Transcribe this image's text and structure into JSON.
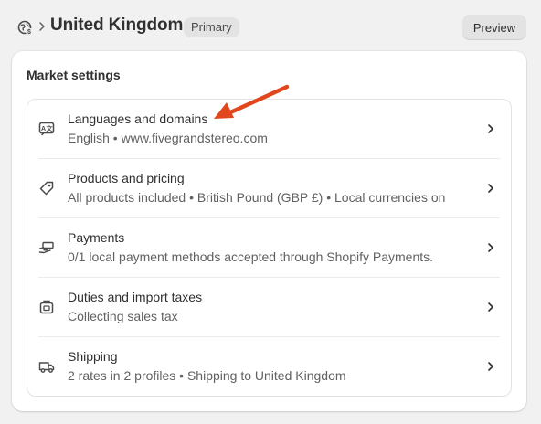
{
  "header": {
    "title": "United Kingdom",
    "badge": "Primary",
    "preview_label": "Preview"
  },
  "card": {
    "title": "Market settings"
  },
  "settings": [
    {
      "title": "Languages and domains",
      "description": "English • www.fivegrandstereo.com",
      "icon": "translate-icon"
    },
    {
      "title": "Products and pricing",
      "description": "All products included • British Pound (GBP £) • Local currencies on",
      "icon": "price-tag-icon"
    },
    {
      "title": "Payments",
      "description": "0/1 local payment methods accepted through Shopify Payments.",
      "icon": "hand-cash-icon"
    },
    {
      "title": "Duties and import taxes",
      "description": "Collecting sales tax",
      "icon": "tax-icon"
    },
    {
      "title": "Shipping",
      "description": "2 rates in 2 profiles • Shipping to United Kingdom",
      "icon": "truck-icon"
    }
  ],
  "colors": {
    "background": "#f1f1f1",
    "card": "#ffffff",
    "annotation_arrow": "#e0471e"
  }
}
